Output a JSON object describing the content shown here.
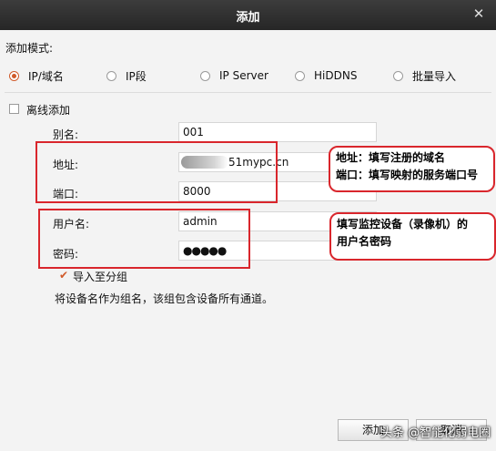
{
  "window": {
    "title": "添加"
  },
  "mode": {
    "label": "添加模式:",
    "options": [
      "IP/域名",
      "IP段",
      "IP Server",
      "HiDDNS",
      "批量导入"
    ],
    "selected": "IP/域名"
  },
  "offline": {
    "label": "离线添加",
    "checked": false
  },
  "form": {
    "alias_label": "别名:",
    "alias_value": "001",
    "address_label": "地址:",
    "address_value": "51mypc.cn",
    "port_label": "端口:",
    "port_value": "8000",
    "user_label": "用户名:",
    "user_value": "admin",
    "password_label": "密码:",
    "password_value": "●●●●●"
  },
  "group": {
    "label": "导入至分组",
    "checked": true,
    "note": "将设备名作为组名，该组包含设备所有通道。"
  },
  "callouts": {
    "address": [
      "地址：填写注册的域名",
      "端口：填写映射的服务端口号"
    ],
    "user": [
      "填写监控设备（录像机）的",
      "用户名密码"
    ]
  },
  "buttons": {
    "ok": "添加",
    "cancel": "取消"
  },
  "watermark": "头条 @智能化弱电圈",
  "colors": {
    "accent": "#d05a2a",
    "annotation": "#d9262c",
    "titlebar": "#2e2e2e"
  }
}
